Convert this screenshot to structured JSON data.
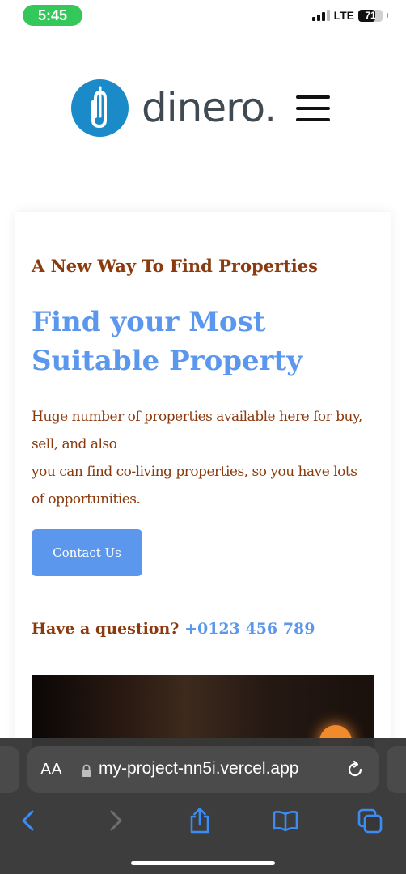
{
  "status_bar": {
    "time": "5:45",
    "network": "LTE",
    "battery": "71",
    "battery_level": 0.71
  },
  "header": {
    "logo_text": "dinero.",
    "logo_icon": "paperclip-icon",
    "menu_icon": "hamburger-menu-icon"
  },
  "hero": {
    "eyebrow": "A New Way To Find Properties",
    "headline": "Find your Most Suitable Property",
    "description_line1": "Huge number of properties available here for buy, sell, and also",
    "description_line2": "you can find co-living properties, so you have lots of opportunities.",
    "contact_button": "Contact Us",
    "question_label": "Have a question?",
    "phone": "+0123 456 789"
  },
  "browser": {
    "text_size_label": "AA",
    "url": "my-project-nn5i.vercel.app",
    "icons": [
      "lock-icon",
      "reload-icon",
      "back-icon",
      "forward-icon",
      "share-icon",
      "bookmarks-icon",
      "tabs-icon"
    ]
  },
  "colors": {
    "brown": "#8b3a0e",
    "blue": "#5b97ec",
    "logo_blue": "#1a8bc8",
    "status_green": "#34c759"
  }
}
